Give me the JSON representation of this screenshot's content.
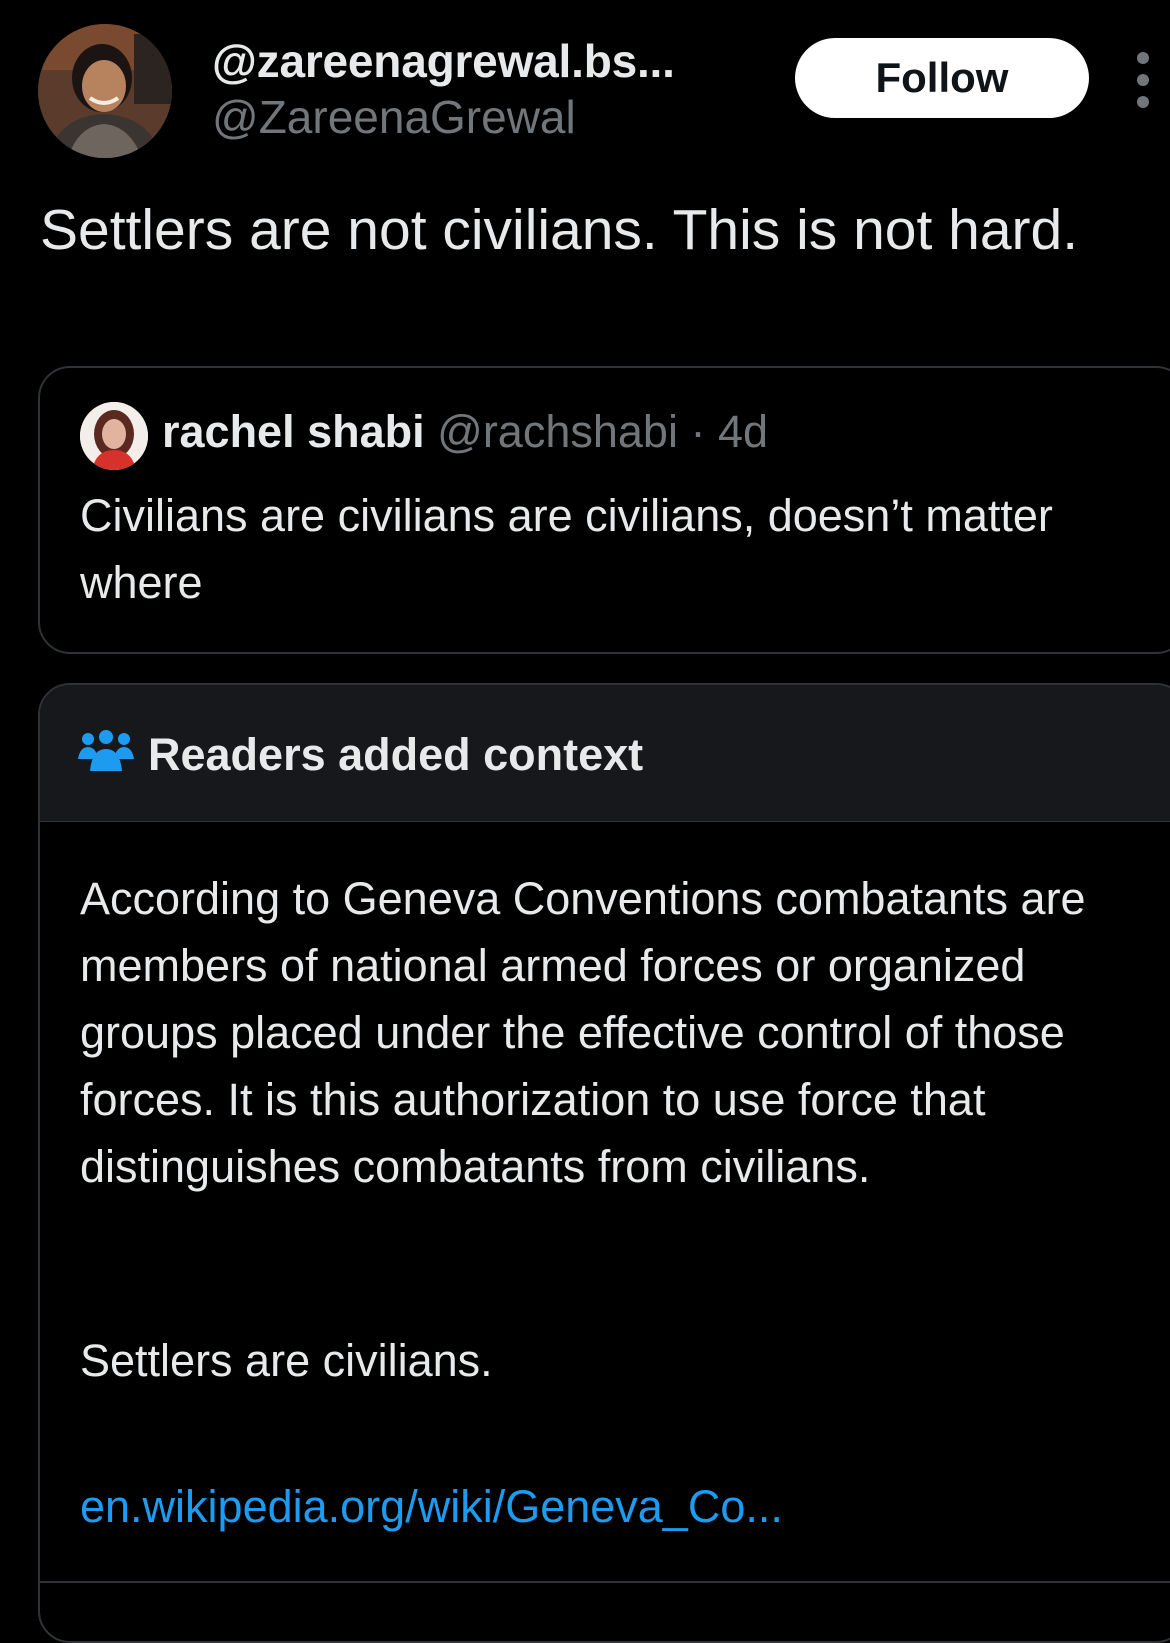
{
  "author": {
    "display_name": "@zareenagrewal.bs...",
    "handle": "@ZareenaGrewal",
    "follow_label": "Follow",
    "more_icon": "more-vertical-icon"
  },
  "tweet": {
    "text": "Settlers are not civilians. This is not hard."
  },
  "quoted": {
    "name": "rachel shabi",
    "handle": "@rachshabi",
    "separator": " · ",
    "time": "4d",
    "text": "Civilians are civilians are civilians, doesn’t matter where"
  },
  "community_note": {
    "icon": "people-group-icon",
    "title": "Readers added context",
    "body": "According to  Geneva Conventions combatants are members of national armed forces or organized groups placed under the effective control of those forces. It is this authorization to use force that distinguishes combatants from civilians.",
    "summary": "Settlers are civilians.",
    "link": "en.wikipedia.org/wiki/Geneva_Co..."
  },
  "colors": {
    "background": "#000000",
    "text": "#e7e9ea",
    "muted": "#71767b",
    "link": "#1d9bf0",
    "border": "#2f3336",
    "note_header_bg": "#16181c"
  }
}
